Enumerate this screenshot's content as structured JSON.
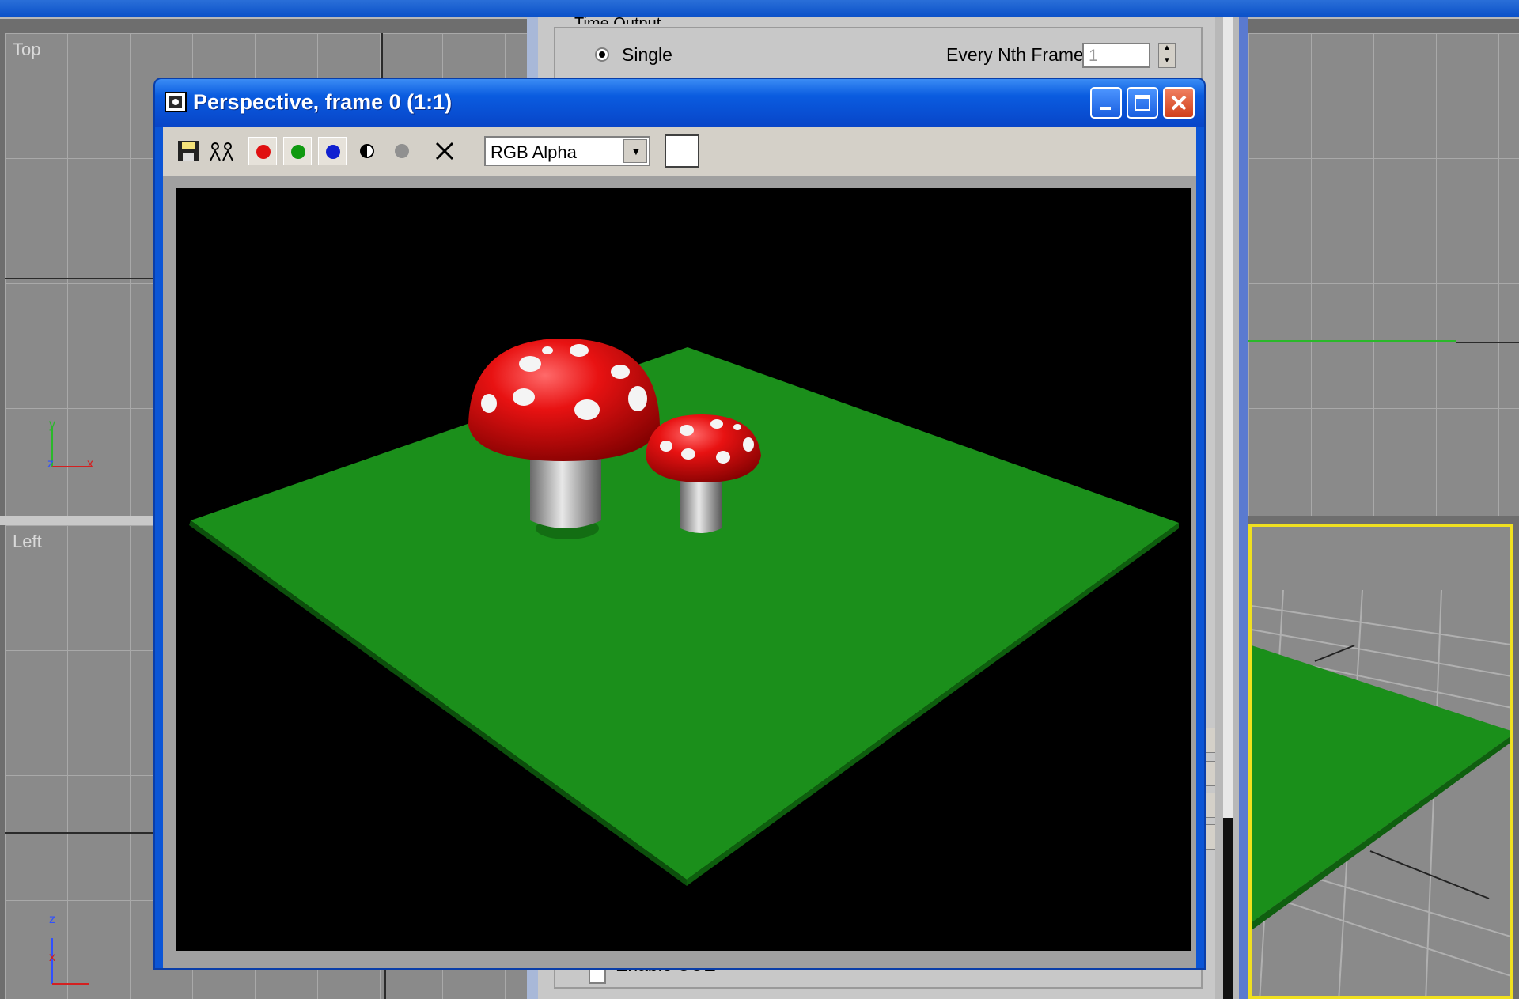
{
  "viewports": {
    "top_label": "Top",
    "left_label": "Left",
    "axis_x": "x",
    "axis_y": "y",
    "axis_z": "z"
  },
  "time_output": {
    "group_label": "Time Output",
    "single_label": "Single",
    "nth_frame_label": "Every Nth Frame:",
    "nth_frame_value": "1",
    "bottom_checkbox_label": "Enable UUE"
  },
  "render_window": {
    "title": "Perspective, frame 0 (1:1)",
    "channel_selected": "RGB Alpha",
    "colors": {
      "title_blue": "#0a5ce0",
      "ground_green": "#1a8f1a",
      "cap_red": "#e01010"
    }
  },
  "icons": [
    "render-frame-icon",
    "save-icon",
    "clone-icon",
    "red-channel-icon",
    "green-channel-icon",
    "blue-channel-icon",
    "mono-icon",
    "alpha-icon",
    "clear-icon",
    "minimize-icon",
    "maximize-icon",
    "close-icon"
  ]
}
